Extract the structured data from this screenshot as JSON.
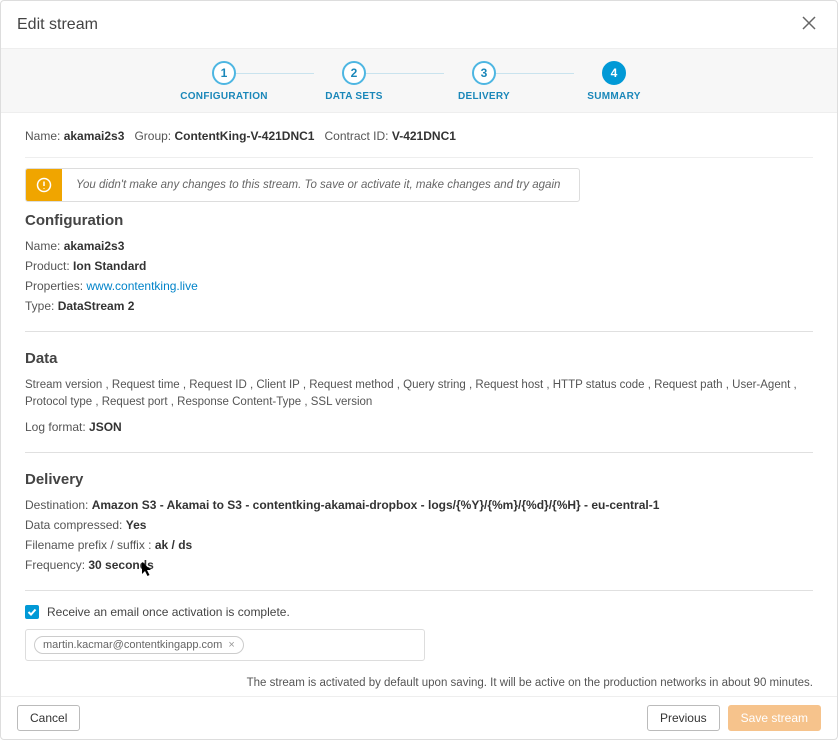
{
  "header": {
    "title": "Edit stream"
  },
  "steps": [
    {
      "num": "1",
      "label": "CONFIGURATION"
    },
    {
      "num": "2",
      "label": "DATA SETS"
    },
    {
      "num": "3",
      "label": "DELIVERY"
    },
    {
      "num": "4",
      "label": "SUMMARY"
    }
  ],
  "meta": {
    "name_label": "Name:",
    "name_value": "akamai2s3",
    "group_label": "Group:",
    "group_value": "ContentKing-V-421DNC1",
    "contract_label": "Contract ID:",
    "contract_value": "V-421DNC1"
  },
  "alert": {
    "message": "You didn't make any changes to this stream. To save or activate it, make changes and try again"
  },
  "configuration": {
    "title": "Configuration",
    "name_label": "Name:",
    "name_value": "akamai2s3",
    "product_label": "Product:",
    "product_value": "Ion Standard",
    "properties_label": "Properties:",
    "properties_link": "www.contentking.live",
    "type_label": "Type:",
    "type_value": "DataStream 2"
  },
  "data": {
    "title": "Data",
    "fields": "Stream version , Request time , Request ID , Client IP , Request method , Query string , Request host , HTTP status code , Request path , User-Agent , Protocol type , Request port , Response Content-Type , SSL version",
    "logformat_label": "Log format:",
    "logformat_value": "JSON"
  },
  "delivery": {
    "title": "Delivery",
    "destination_label": "Destination:",
    "destination_value": "Amazon S3 - Akamai to S3 - contentking-akamai-dropbox - logs/{%Y}/{%m}/{%d}/{%H} - eu-central-1",
    "compressed_label": "Data compressed:",
    "compressed_value": "Yes",
    "filename_label": "Filename prefix / suffix :",
    "filename_value": "ak / ds",
    "frequency_label": "Frequency:",
    "frequency_value": "30 seconds"
  },
  "notify": {
    "checkbox_label": "Receive an email once activation is complete.",
    "email": "martin.kacmar@contentkingapp.com"
  },
  "footer_note": "The stream is activated by default upon saving. It will be active on the production networks in about 90 minutes.",
  "buttons": {
    "cancel": "Cancel",
    "previous": "Previous",
    "save": "Save stream"
  }
}
